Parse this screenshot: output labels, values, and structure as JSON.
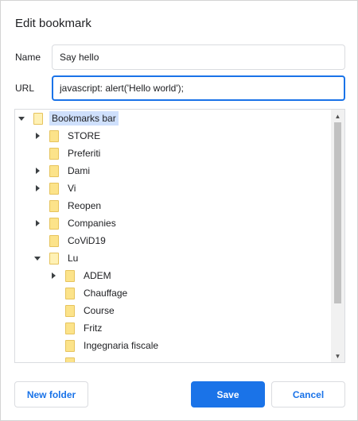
{
  "dialog": {
    "title": "Edit bookmark",
    "name_label": "Name",
    "name_value": "Say hello",
    "url_label": "URL",
    "url_value": "javascript: alert('Hello world');"
  },
  "tree": {
    "nodes": [
      {
        "label": "Bookmarks bar",
        "expander": "expanded",
        "selected": true
      },
      {
        "label": "STORE",
        "expander": "collapsed"
      },
      {
        "label": "Preferiti",
        "expander": "none"
      },
      {
        "label": "Dami",
        "expander": "collapsed"
      },
      {
        "label": "Vi",
        "expander": "collapsed"
      },
      {
        "label": "Reopen",
        "expander": "none"
      },
      {
        "label": "Companies",
        "expander": "collapsed"
      },
      {
        "label": "CoViD19",
        "expander": "none"
      },
      {
        "label": "Lu",
        "expander": "expanded"
      },
      {
        "label": "ADEM",
        "expander": "collapsed"
      },
      {
        "label": "Chauffage",
        "expander": "none"
      },
      {
        "label": "Course",
        "expander": "none"
      },
      {
        "label": "Fritz",
        "expander": "none"
      },
      {
        "label": "Ingegnaria fiscale",
        "expander": "none"
      }
    ]
  },
  "buttons": {
    "new_folder": "New folder",
    "save": "Save",
    "cancel": "Cancel"
  },
  "colors": {
    "accent": "#1a73e8",
    "selection": "#cfe0fc",
    "folder": "#fce38a"
  }
}
